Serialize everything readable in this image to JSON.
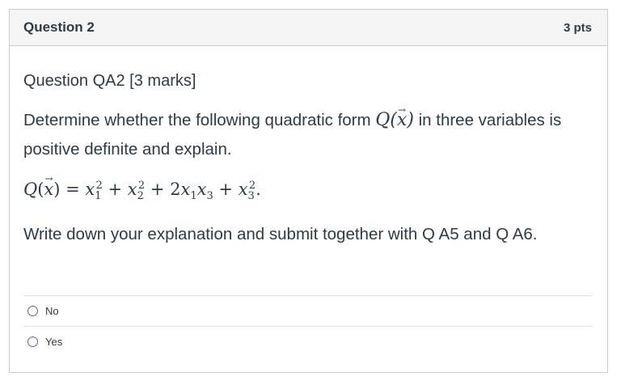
{
  "question": {
    "title": "Question 2",
    "points": "3 pts",
    "heading": "Question QA2 [3 marks]",
    "prompt_before": "Determine  whether the following quadratic form ",
    "prompt_math": "Q(x)",
    "prompt_after": " in three variables is positive definite and explain.",
    "formula_lhs": "Q(x)",
    "formula_rhs": "= x₁² + x₂² + 2x₁x₃ + x₃².",
    "instruction": "Write down your explanation and submit together with Q A5 and Q A6."
  },
  "answers": [
    {
      "label": "No"
    },
    {
      "label": "Yes"
    }
  ]
}
